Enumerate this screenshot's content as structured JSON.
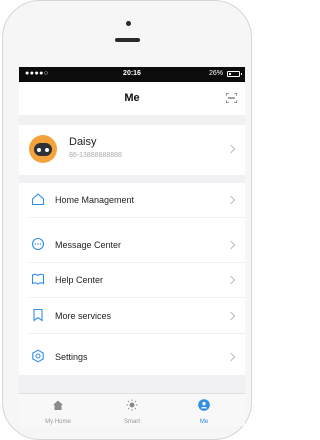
{
  "statusbar": {
    "signal": "●●●●○",
    "time": "20:16",
    "battery_text": "26%",
    "battery_level": 0.26
  },
  "navbar": {
    "title": "Me"
  },
  "profile": {
    "name": "Daisy",
    "phone": "86-13888888888"
  },
  "menu": {
    "items": [
      {
        "label": "Home Management",
        "icon": "house-icon"
      },
      {
        "label": "Message Center",
        "icon": "chat-bubble-icon"
      },
      {
        "label": "Help Center",
        "icon": "book-icon"
      },
      {
        "label": "More services",
        "icon": "bookmark-icon"
      },
      {
        "label": "Settings",
        "icon": "settings-hexagon-icon"
      }
    ]
  },
  "tabbar": {
    "tabs": [
      {
        "label": "My Home",
        "icon": "home-icon"
      },
      {
        "label": "Smart",
        "icon": "sun-icon"
      },
      {
        "label": "Me",
        "icon": "person-icon",
        "active": true
      }
    ]
  },
  "colors": {
    "accent": "#2f8fe5",
    "avatar": "#f3a33a",
    "background": "#f1f1f3"
  }
}
